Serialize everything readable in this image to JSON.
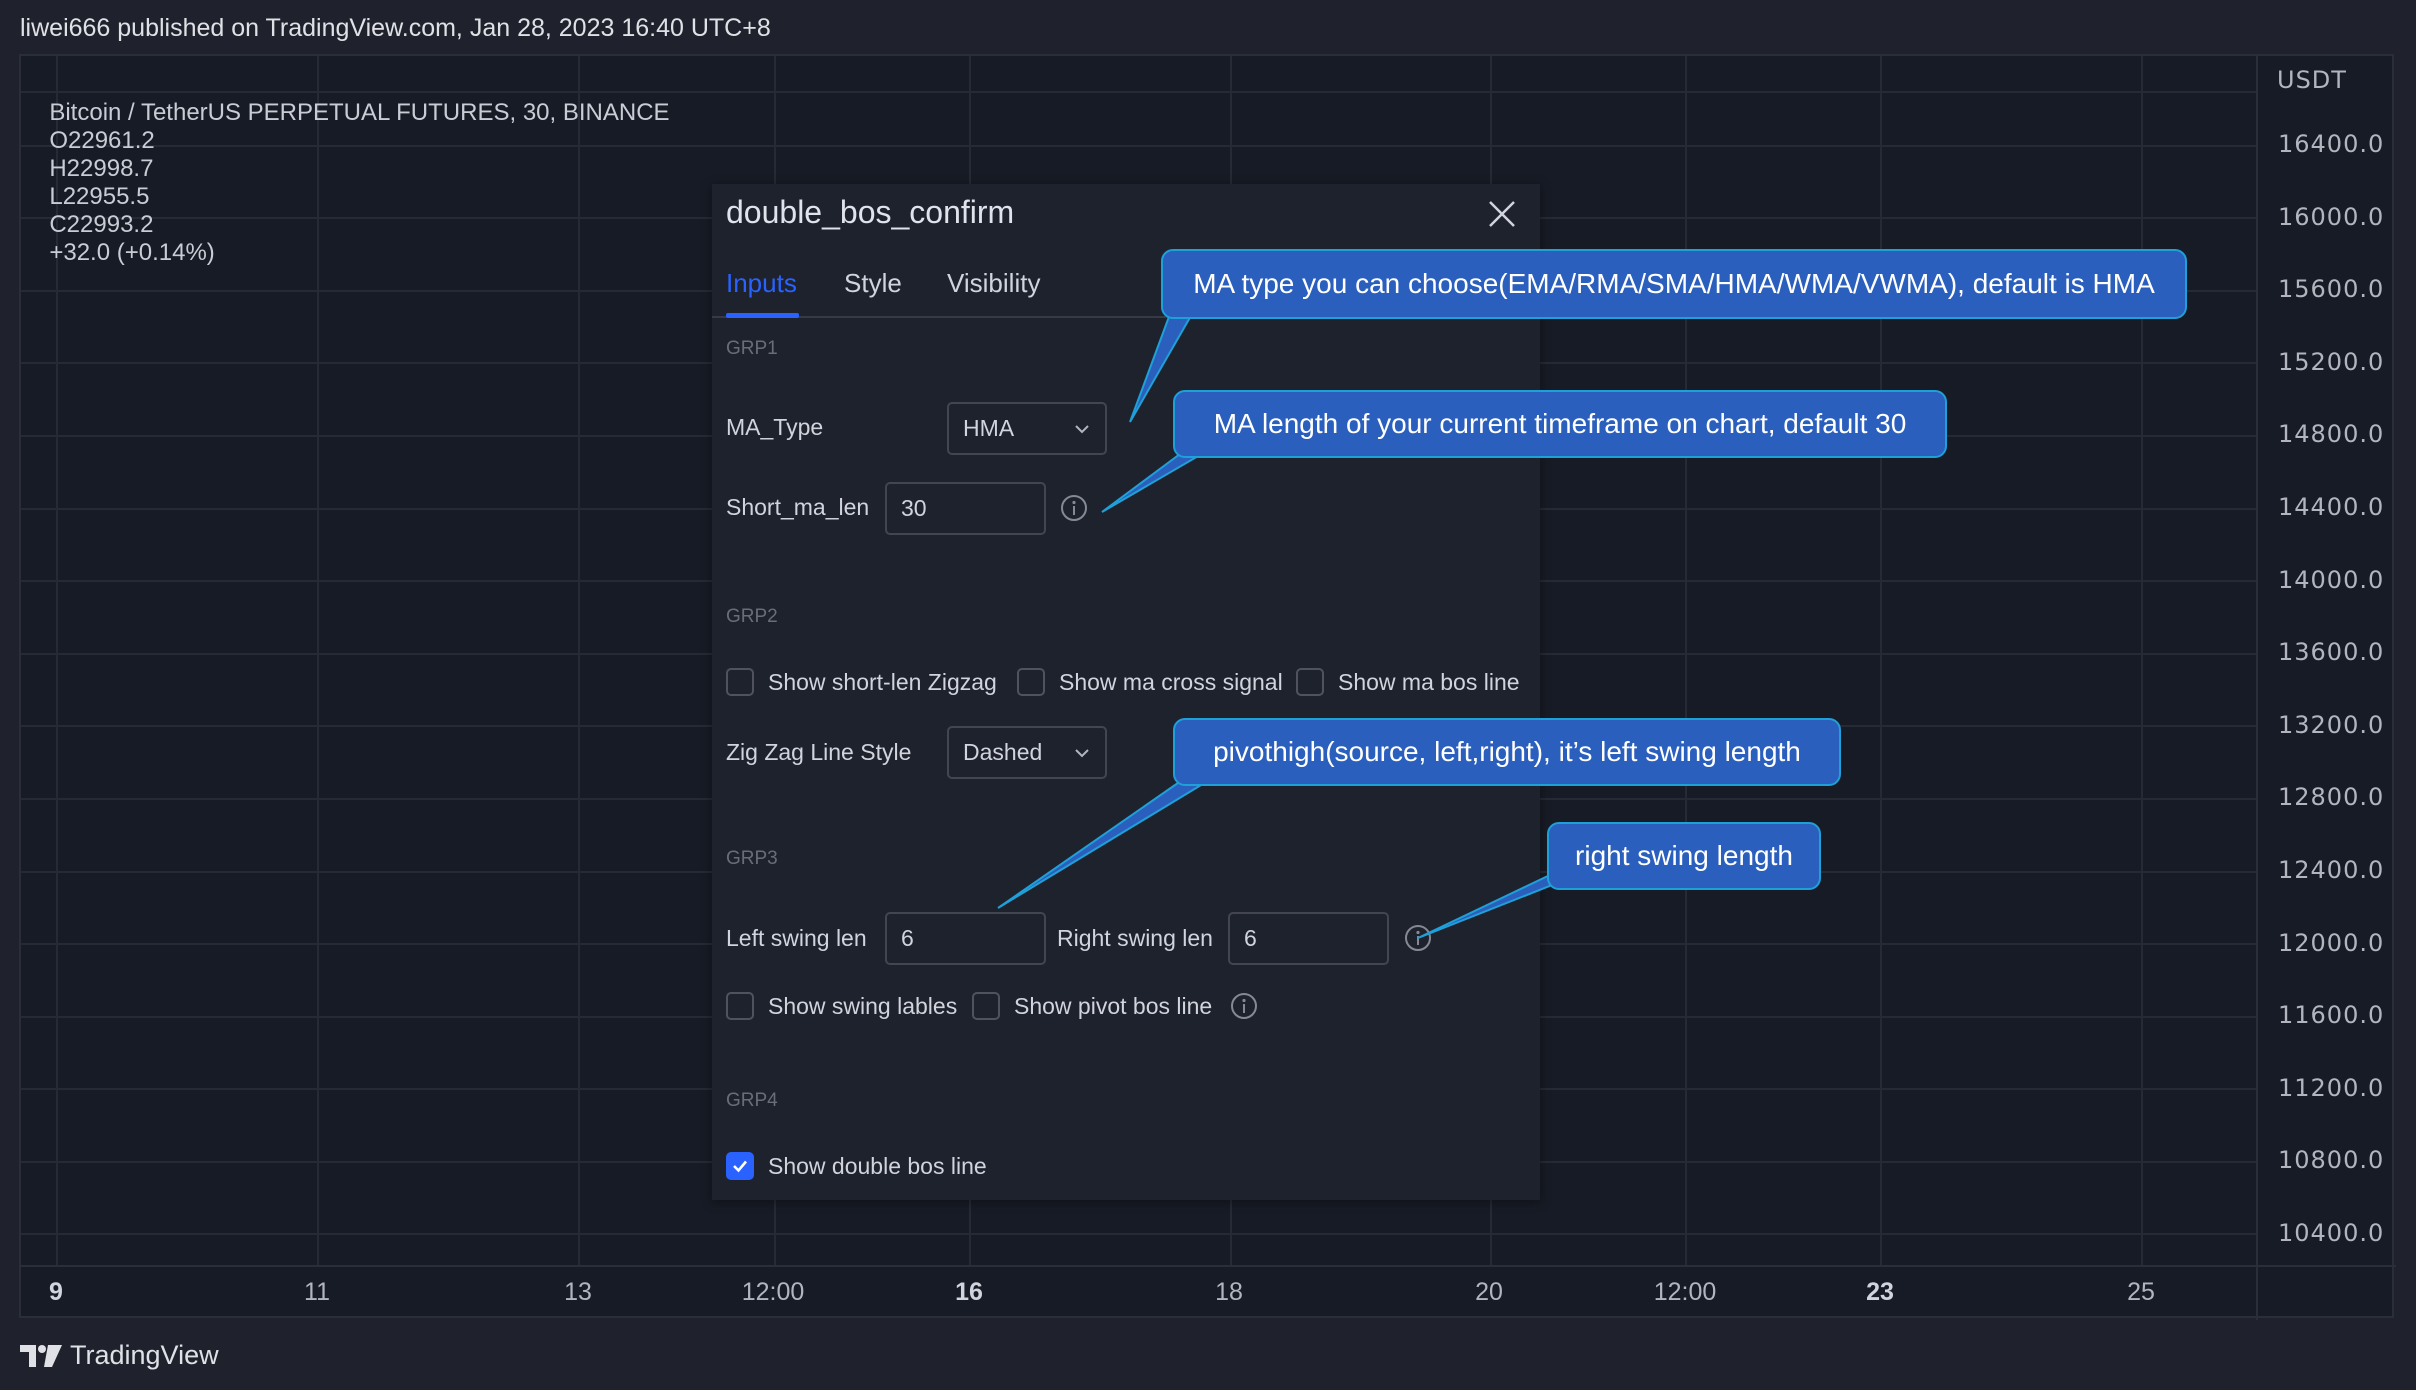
{
  "publication": "liwei666 published on TradingView.com, Jan 28, 2023 16:40 UTC+8",
  "symbol": {
    "name": "Bitcoin / TetherUS PERPETUAL FUTURES, 30, BINANCE",
    "open": "O22961.2",
    "high": "H22998.7",
    "low": "L22955.5",
    "close": "C22993.2",
    "change": "+32.0 (+0.14%)"
  },
  "price_axis": {
    "currency": "USDT",
    "labels": [
      "16400.0",
      "16000.0",
      "15600.0",
      "15200.0",
      "14800.0",
      "14400.0",
      "14000.0",
      "13600.0",
      "13200.0",
      "12800.0",
      "12400.0",
      "12000.0",
      "11600.0",
      "11200.0",
      "10800.0",
      "10400.0"
    ]
  },
  "time_axis": {
    "labels": [
      {
        "text": "9",
        "bold": true
      },
      {
        "text": "11",
        "bold": false
      },
      {
        "text": "13",
        "bold": false
      },
      {
        "text": "12:00",
        "bold": false
      },
      {
        "text": "16",
        "bold": true
      },
      {
        "text": "18",
        "bold": false
      },
      {
        "text": "20",
        "bold": false
      },
      {
        "text": "12:00",
        "bold": false
      },
      {
        "text": "23",
        "bold": true
      },
      {
        "text": "25",
        "bold": false
      }
    ]
  },
  "footer": {
    "brand": "TradingView"
  },
  "dialog": {
    "title": "double_bos_confirm",
    "tabs": [
      {
        "label": "Inputs",
        "active": true
      },
      {
        "label": "Style",
        "active": false
      },
      {
        "label": "Visibility",
        "active": false
      }
    ],
    "grp1": {
      "title": "GRP1",
      "ma_type_label": "MA_Type",
      "ma_type_value": "HMA",
      "short_ma_len_label": "Short_ma_len",
      "short_ma_len_value": "30"
    },
    "grp2": {
      "title": "GRP2",
      "checkboxes": [
        {
          "label": "Show short-len Zigzag",
          "checked": false
        },
        {
          "label": "Show ma cross signal",
          "checked": false
        },
        {
          "label": "Show ma bos line",
          "checked": false
        }
      ],
      "zigzag_style_label": "Zig Zag Line Style",
      "zigzag_style_value": "Dashed"
    },
    "grp3": {
      "title": "GRP3",
      "left_swing_label": "Left swing len",
      "left_swing_value": "6",
      "right_swing_label": "Right swing len",
      "right_swing_value": "6",
      "checkboxes": [
        {
          "label": "Show swing lables",
          "checked": false
        },
        {
          "label": "Show pivot bos line",
          "checked": false
        }
      ]
    },
    "grp4": {
      "title": "GRP4",
      "checkboxes": [
        {
          "label": "Show double bos line",
          "checked": true
        }
      ]
    }
  },
  "callouts": [
    "MA type you can choose(EMA/RMA/SMA/HMA/WMA/VWMA), default is HMA",
    "MA length of your current timeframe on chart, default 30",
    "pivothigh(source, left,right), it’s left swing length",
    "right swing length"
  ],
  "colors": {
    "accent": "#2962ff",
    "callout_bg": "#2b5fbd",
    "callout_border": "#1fa0d8",
    "chart_bg": "#171b25",
    "dialog_bg": "#1e222d"
  }
}
